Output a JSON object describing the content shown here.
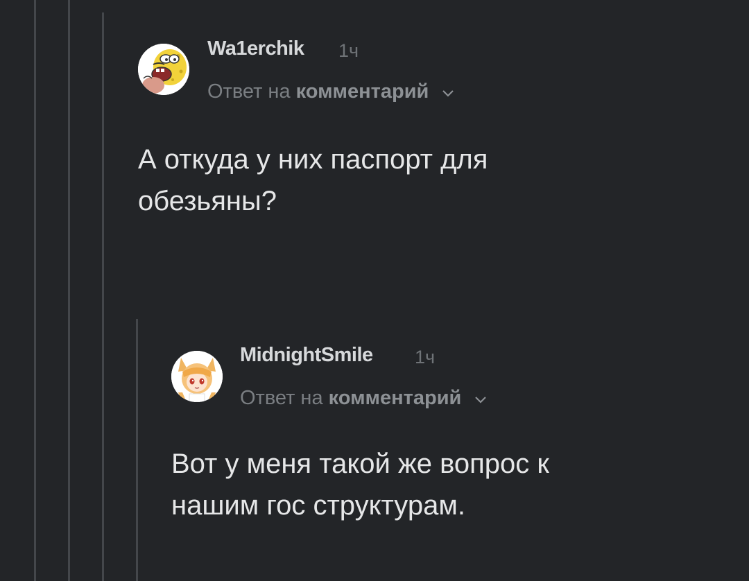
{
  "thread": {
    "comments": [
      {
        "username": "Wa1erchik",
        "time": "1ч",
        "reply_prefix": "Ответ на",
        "reply_link": "комментарий",
        "text_line1": "А откуда у них паспорт для",
        "text_line2": "обезьяны?",
        "avatar_icon": "spongebob-caveman-avatar"
      },
      {
        "username": "MidnightSmile",
        "time": "1ч",
        "reply_prefix": "Ответ на",
        "reply_link": "комментарий",
        "text_line1": "Вот у меня такой же вопрос к",
        "text_line2": "нашим гос структурам.",
        "avatar_icon": "anime-fox-girl-avatar"
      }
    ]
  },
  "colors": {
    "background": "#232528",
    "thread_line": "#44474b",
    "text": "#e6e7e8",
    "muted": "#7a7e82"
  }
}
